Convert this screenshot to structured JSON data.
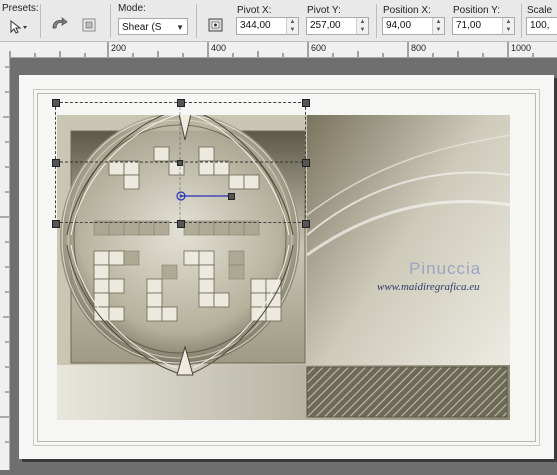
{
  "toolbar": {
    "presets_label": "Presets:",
    "mode_label": "Mode:",
    "mode_value": "Shear (S",
    "pivot_x_label": "Pivot X:",
    "pivot_x_value": "344,00",
    "pivot_y_label": "Pivot Y:",
    "pivot_y_value": "257,00",
    "position_x_label": "Position X:",
    "position_x_value": "94,00",
    "position_y_label": "Position Y:",
    "position_y_value": "71,00",
    "scale_label": "Scale",
    "scale_value": "100,"
  },
  "ruler": {
    "labels": [
      "200",
      "400",
      "600",
      "800",
      "1000"
    ]
  },
  "watermark": {
    "name": "Pinuccia",
    "url": "www.maidiregrafica.eu"
  },
  "colors": {
    "canvas_bg": "#6f6f6f",
    "image_tone": "#b7b3a0",
    "pivot_line": "#2830b8"
  }
}
